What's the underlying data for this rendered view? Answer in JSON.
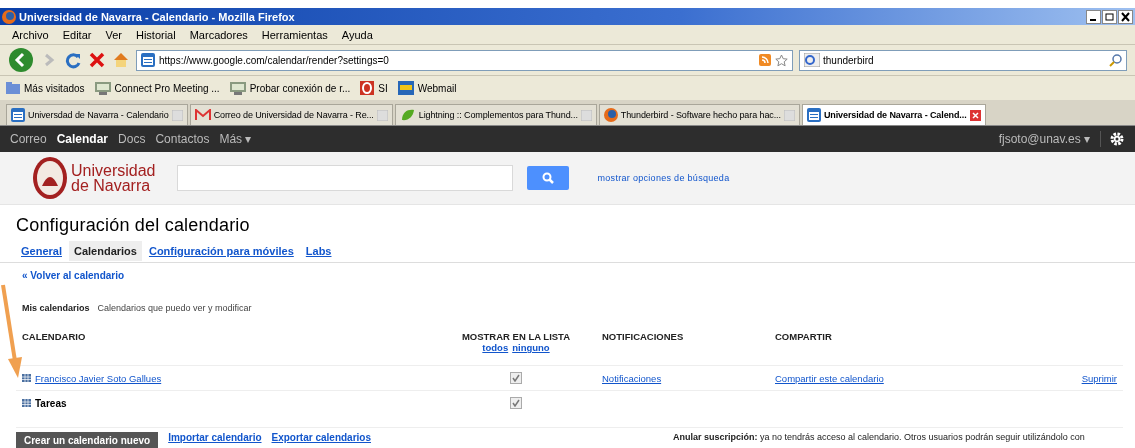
{
  "window": {
    "title": "Universidad de Navarra - Calendario - Mozilla Firefox"
  },
  "menu": [
    "Archivo",
    "Editar",
    "Ver",
    "Historial",
    "Marcadores",
    "Herramientas",
    "Ayuda"
  ],
  "address": {
    "value": "https://www.google.com/calendar/render?settings=0"
  },
  "search": {
    "value": "thunderbird"
  },
  "bookmarks": [
    {
      "label": "Más visitados",
      "kind": "folder"
    },
    {
      "label": "Connect Pro Meeting ...",
      "kind": "page"
    },
    {
      "label": "Probar conexión de r...",
      "kind": "page"
    },
    {
      "label": "SI",
      "kind": "opera"
    },
    {
      "label": "Webmail",
      "kind": "mail"
    }
  ],
  "tabs": [
    {
      "label": "Universdad de Navarra - Calendario",
      "kind": "calendar",
      "selected": false
    },
    {
      "label": "Correo de Universidad de Navarra - Re...",
      "kind": "gmail",
      "selected": false
    },
    {
      "label": "Lightning :: Complementos para Thund...",
      "kind": "lightning",
      "selected": false
    },
    {
      "label": "Thunderbird - Software hecho para hac...",
      "kind": "firefox",
      "selected": false
    },
    {
      "label": "Universidad de Navarra - Calend...",
      "kind": "calendar",
      "selected": true
    }
  ],
  "google_bar": {
    "items": [
      {
        "label": "Correo",
        "selected": false
      },
      {
        "label": "Calendar",
        "selected": true
      },
      {
        "label": "Docs",
        "selected": false
      },
      {
        "label": "Contactos",
        "selected": false
      },
      {
        "label": "Más ▾",
        "selected": false
      }
    ],
    "account": "fjsoto@unav.es ▾"
  },
  "header": {
    "logo_line_1": "Universidad",
    "logo_line_2": "de Navarra",
    "search_options": "mostrar opciones de búsqueda"
  },
  "page": {
    "title": "Configuración del calendario",
    "tabs": [
      {
        "label": "General",
        "selected": false
      },
      {
        "label": "Calendarios",
        "selected": true
      },
      {
        "label": "Configuración para móviles",
        "selected": false
      },
      {
        "label": "Labs",
        "selected": false
      }
    ],
    "back_link": "« Volver al calendario",
    "section": {
      "title": "Mis calendarios",
      "subtitle": "Calendarios que puedo ver y modificar"
    },
    "columns": [
      "CALENDARIO",
      "MOSTRAR EN LA LISTA",
      "NOTIFICACIONES",
      "COMPARTIR"
    ],
    "show_links": [
      "todos",
      "ninguno"
    ],
    "rows": [
      {
        "name": "Francisco Javier Soto Gallues",
        "link": true,
        "checked": true,
        "notifications": "Notificaciones",
        "share": "Compartir este calendario",
        "delete": "Suprimir"
      },
      {
        "name": "Tareas",
        "link": false,
        "checked": true
      }
    ],
    "create_button": "Crear un calendario nuevo",
    "links": [
      "Importar calendario",
      "Exportar calendarios"
    ],
    "note": "**Anular suscripción:** ya no tendrás acceso al calendario. Otros usuarios podrán seguir utilizándolo con"
  }
}
